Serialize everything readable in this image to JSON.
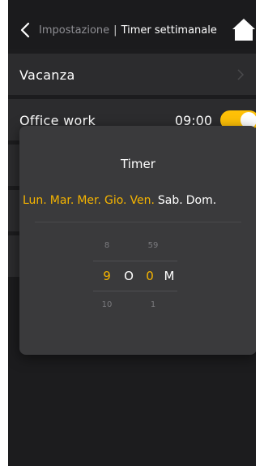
{
  "header": {
    "back_icon": "chevron-left-icon",
    "breadcrumb_parent": "Impostazione",
    "breadcrumb_separator": "|",
    "title": "Timer settimanale",
    "home_icon": "home-icon"
  },
  "list": {
    "items": [
      {
        "label": "Vacanza"
      },
      {
        "label": "Office work",
        "time": "09:00",
        "enabled": true
      }
    ]
  },
  "dialog": {
    "title": "Timer",
    "days": [
      {
        "label": "Lun.",
        "selected": true
      },
      {
        "label": "Mar.",
        "selected": true
      },
      {
        "label": "Mer.",
        "selected": true
      },
      {
        "label": "Gio.",
        "selected": true
      },
      {
        "label": "Ven.",
        "selected": true
      },
      {
        "label": "Sab.",
        "selected": false
      },
      {
        "label": "Dom.",
        "selected": false
      }
    ],
    "picker": {
      "hour_prev": "8",
      "hour": "9",
      "hour_next": "10",
      "separator": "O",
      "minute_prev": "59",
      "minute": "0",
      "minute_next": "1",
      "suffix": "M"
    }
  },
  "colors": {
    "accent": "#f5b400",
    "background": "#1c1c1e",
    "row": "#2c2c2e",
    "dialog": "#3a3a3c"
  }
}
